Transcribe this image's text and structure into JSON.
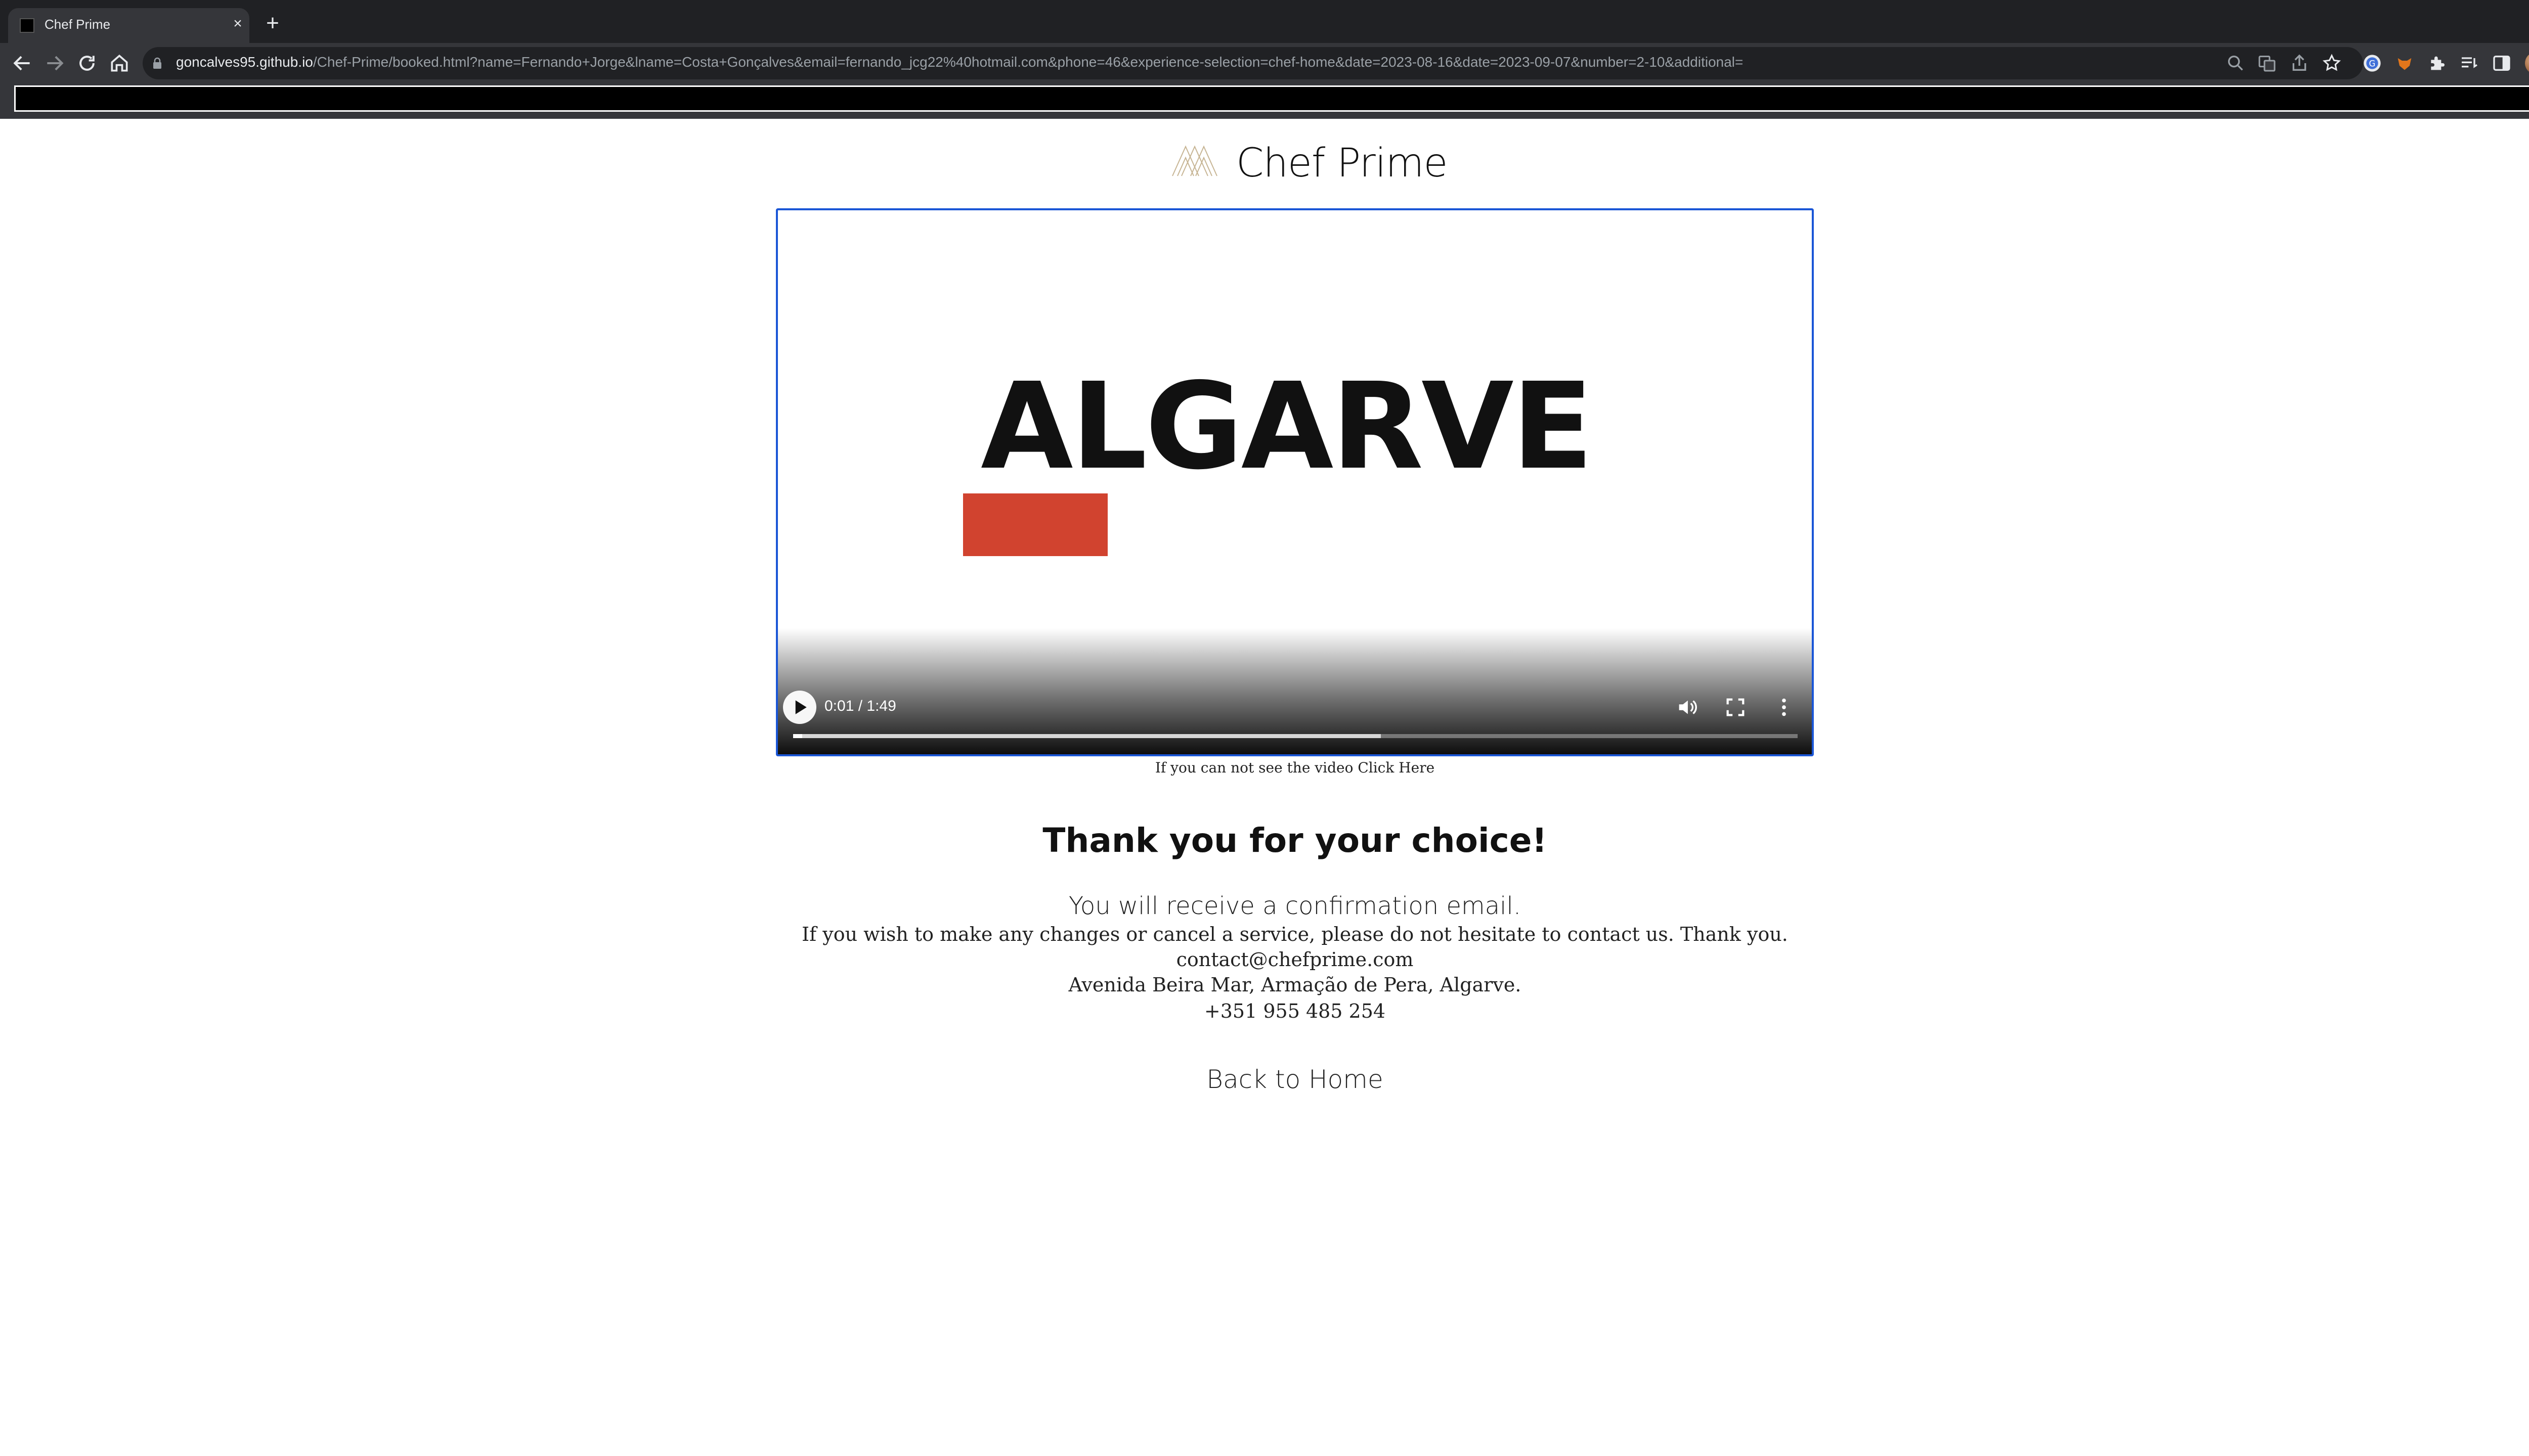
{
  "browser": {
    "tab": {
      "title": "Chef Prime"
    },
    "url": {
      "host": "goncalves95.github.io",
      "path": "/Chef-Prime/booked.html?name=Fernando+Jorge&lname=Costa+Gonçalves&email=fernando_jcg22%40hotmail.com&phone=46&experience-selection=chef-home&date=2023-08-16&date=2023-09-07&number=2-10&additional="
    }
  },
  "brand": {
    "name": "Chef Prime"
  },
  "video": {
    "frame_text": "ALGARVE",
    "time": "0:01 / 1:49",
    "progress": 0.009,
    "buffered": 0.585,
    "caption": "If you can not see the video Click Here"
  },
  "confirmation": {
    "heading": "Thank you for your choice!",
    "subheading": "You will receive a confirmation email.",
    "message": "If you wish to make any changes or cancel a service, please do not hesitate to contact us. Thank you.",
    "email": "contact@chefprime.com",
    "address": "Avenida Beira Mar, Armação de Pera, Algarve.",
    "phone": "+351 955 485 254",
    "back_link": "Back to Home"
  }
}
